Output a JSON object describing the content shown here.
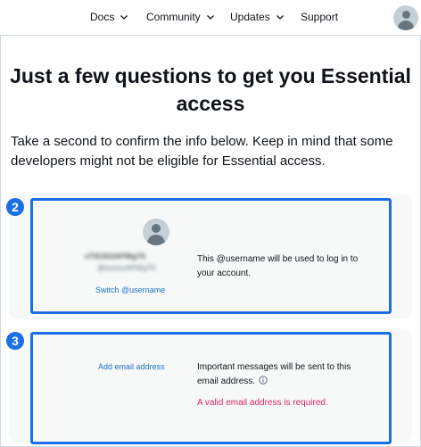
{
  "nav": {
    "items": [
      {
        "label": "Docs",
        "has_dropdown": true
      },
      {
        "label": "Community",
        "has_dropdown": true
      },
      {
        "label": "Updates",
        "has_dropdown": true
      },
      {
        "label": "Support",
        "has_dropdown": false
      }
    ],
    "avatar_icon": "default-avatar-icon"
  },
  "page": {
    "title": "Just a few questions to get you Essential access",
    "intro": "Take a second to confirm the info below. Keep in mind that some developers might not be eligible for Essential access."
  },
  "account_card": {
    "step": "2",
    "username_blurred": "vTSUSOAPWgT0",
    "handle_blurred": "@tsoiooAPWgT0",
    "switch_link": "Switch @username",
    "description": "This @username will be used to log in to your account."
  },
  "email_card": {
    "step": "3",
    "add_email_link": "Add email address",
    "description": "Important messages will be sent to this email address.",
    "error": "A valid email address is required."
  },
  "colors": {
    "accent": "#1a6fe6",
    "link": "#1d6fc9",
    "error": "#e0245e",
    "card_bg": "#f7f9f9"
  }
}
